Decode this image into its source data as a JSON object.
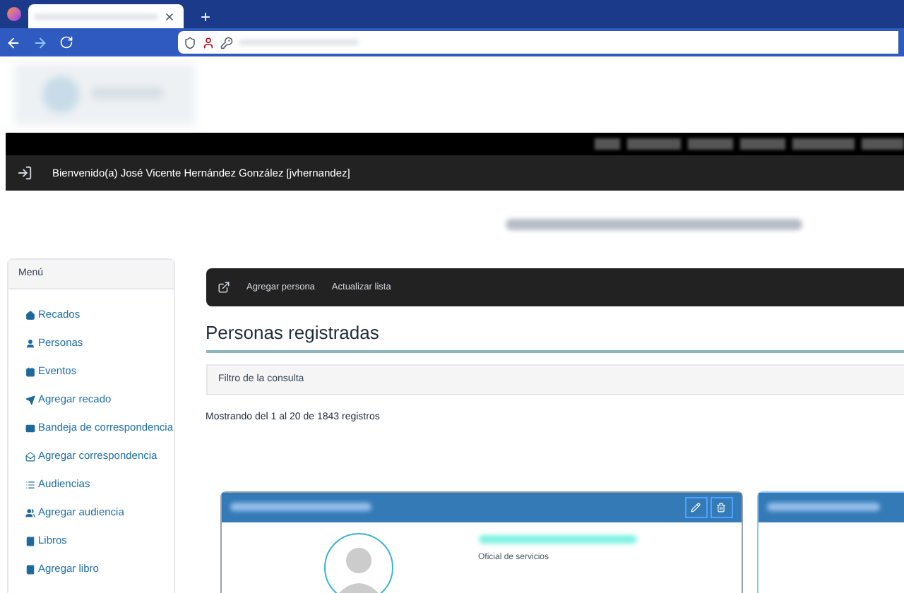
{
  "browser": {
    "new_tab": "+"
  },
  "header": {
    "welcome": "Bienvenido(a) José Vicente Hernández González [jvhernandez]"
  },
  "sidebar": {
    "title": "Menú",
    "items": [
      {
        "label": "Recados"
      },
      {
        "label": "Personas"
      },
      {
        "label": "Eventos"
      },
      {
        "label": "Agregar recado"
      },
      {
        "label": "Bandeja de correspondencia"
      },
      {
        "label": "Agregar correspondencia"
      },
      {
        "label": "Audiencias"
      },
      {
        "label": "Agregar audiencia"
      },
      {
        "label": "Libros"
      },
      {
        "label": "Agregar libro"
      }
    ]
  },
  "toolbar": {
    "actions": [
      "Agregar persona",
      "Actualizar lista"
    ]
  },
  "content": {
    "heading": "Personas registradas",
    "filter": "Filtro de la consulta",
    "summary": "Mostrando del 1 al 20 de 1843 registros"
  },
  "cards": [
    {
      "subtitle": "Oficial de servicios"
    }
  ]
}
